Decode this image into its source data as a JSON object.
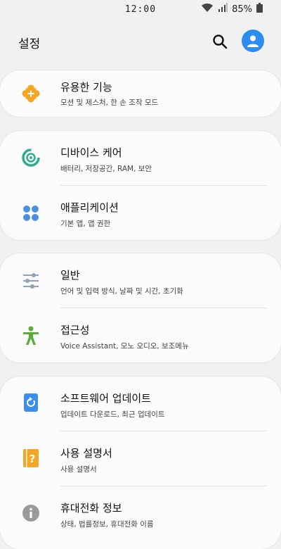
{
  "status_bar": {
    "time": "12:00",
    "battery": "85%"
  },
  "header": {
    "title": "설정"
  },
  "menu": {
    "useful_features": {
      "title": "유용한 기능",
      "subtitle": "모션 및 제스처, 한 손 조작 모드"
    },
    "device_care": {
      "title": "디바이스 케어",
      "subtitle": "배터리, 저장공간, RAM, 보안"
    },
    "apps": {
      "title": "애플리케이션",
      "subtitle": "기본 앱, 앱 권한"
    },
    "general": {
      "title": "일반",
      "subtitle": "언어 및 입력 방식, 날짜 및 시간, 초기화"
    },
    "accessibility": {
      "title": "접근성",
      "subtitle": "Voice Assistant, 모노 오디오, 보조메뉴"
    },
    "software_update": {
      "title": "소프트웨어 업데이트",
      "subtitle": "업데이트 다운로드, 최근 업데이트"
    },
    "manual": {
      "title": "사용 설명서",
      "subtitle": "사용 설명서"
    },
    "phone_info": {
      "title": "휴대전화 정보",
      "subtitle": "상태, 법률정보, 휴대전화 이름"
    }
  },
  "colors": {
    "useful_features_icon": "#f5a623",
    "device_care_icon": "#2fae8e",
    "apps_icon": "#4a90e2",
    "general_icon": "#8fa3b8",
    "accessibility_icon": "#5cab3c",
    "software_update_icon": "#3b8fe8",
    "manual_icon": "#f5a623",
    "phone_info_icon": "#9a9a9a",
    "avatar": "#2d8cf0"
  }
}
